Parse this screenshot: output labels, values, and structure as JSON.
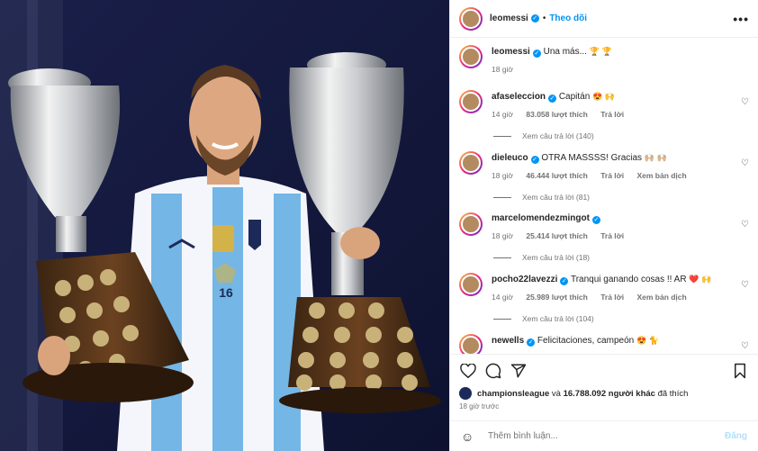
{
  "post": {
    "username": "leomessi",
    "follow_label": "Theo dõi",
    "caption": "Una más...",
    "caption_emojis": "🏆 🏆",
    "caption_time": "18 giờ",
    "jersey_number": "16"
  },
  "comments": [
    {
      "username": "afaseleccion",
      "text": "Capitán",
      "emoji": "😍 🙌",
      "time": "14 giờ",
      "likes": "83.058 lượt thích",
      "reply": "Trả lời",
      "translate": "",
      "replies": "Xem câu trả lời (140)"
    },
    {
      "username": "dieleuco",
      "text": "OTRA MASSSS! Gracias",
      "emoji": "🙌🏼 🙌🏼",
      "time": "18 giờ",
      "likes": "46.444 lượt thích",
      "reply": "Trả lời",
      "translate": "Xem bản dịch",
      "replies": "Xem câu trả lời (81)"
    },
    {
      "username": "marcelomendezmingot",
      "text": "",
      "emoji": "",
      "time": "18 giờ",
      "likes": "25.414 lượt thích",
      "reply": "Trả lời",
      "translate": "",
      "replies": "Xem câu trả lời (18)"
    },
    {
      "username": "pocho22lavezzi",
      "text": "Tranqui ganando cosas !! AR",
      "emoji": "❤️ 🙌",
      "time": "14 giờ",
      "likes": "25.989 lượt thích",
      "reply": "Trả lời",
      "translate": "Xem bản dịch",
      "replies": "Xem câu trả lời (104)"
    },
    {
      "username": "newells",
      "text": "Felicitaciones, campeón",
      "emoji": "😍 🐈",
      "time": "",
      "likes": "",
      "reply": "",
      "translate": "",
      "replies": ""
    }
  ],
  "likes_line": {
    "user": "championsleague",
    "connector": "và",
    "others": "16.788.092 người khác",
    "suffix": "đã thích"
  },
  "posted_ago": "18 giờ trước",
  "add_comment": {
    "placeholder": "Thêm bình luận...",
    "post_label": "Đăng"
  },
  "icons": {
    "heart": "heart-icon",
    "comment": "comment-icon",
    "share": "share-icon",
    "save": "bookmark-icon",
    "more": "more-options-icon",
    "emoji": "emoji-icon"
  },
  "colors": {
    "accent": "#0095f6",
    "muted": "#737373",
    "post_disabled": "#b2dffc"
  }
}
